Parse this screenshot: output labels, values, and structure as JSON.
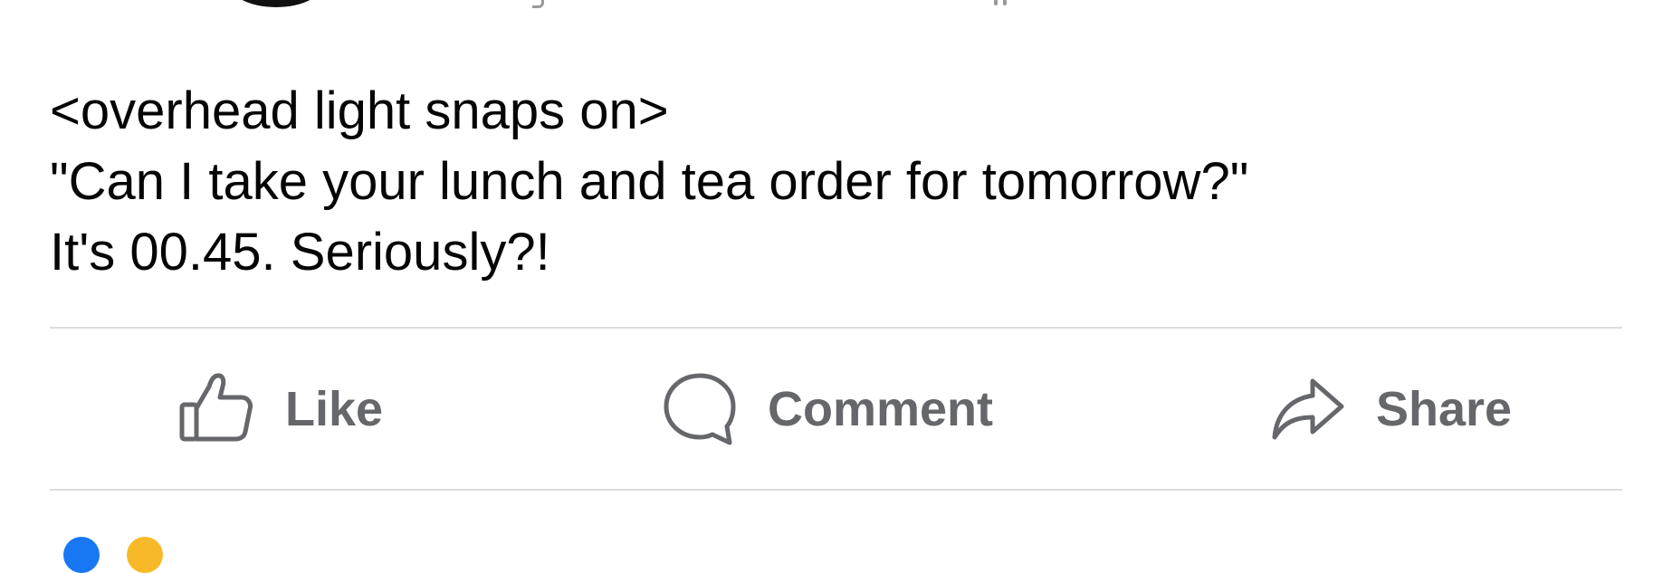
{
  "post": {
    "lines": [
      "<overhead light snaps on>",
      "\"Can I take your lunch and tea order for tomorrow?\"",
      "It's 00.45. Seriously?!"
    ]
  },
  "actions": {
    "like_label": "Like",
    "comment_label": "Comment",
    "share_label": "Share"
  },
  "icons": {
    "like": "thumbs-up-icon",
    "comment": "speech-bubble-icon",
    "share": "share-arrow-icon"
  },
  "colors": {
    "text": "#050505",
    "action_text": "#65676b",
    "divider": "#dcdcdc",
    "like_reaction": "#1877f2",
    "laugh_reaction": "#f7b928"
  }
}
